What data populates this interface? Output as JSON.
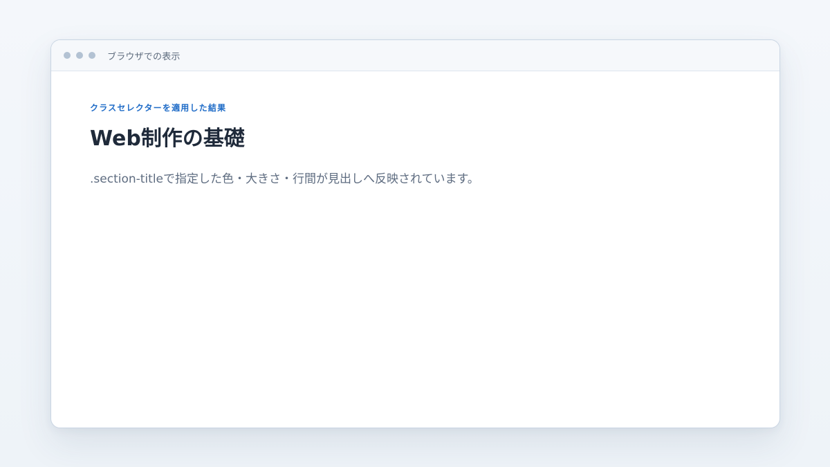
{
  "window": {
    "title": "ブラウザでの表示",
    "dot_color": "#b3c2d3"
  },
  "content": {
    "eyebrow": "クラスセレクターを適用した結果",
    "heading": "Web制作の基礎",
    "description": ".section-titleで指定した色・大きさ・行間が見出しへ反映されています。"
  },
  "colors": {
    "accent": "#1e6bc7",
    "heading": "#1f2a3a",
    "body_text": "#5e6c80"
  }
}
